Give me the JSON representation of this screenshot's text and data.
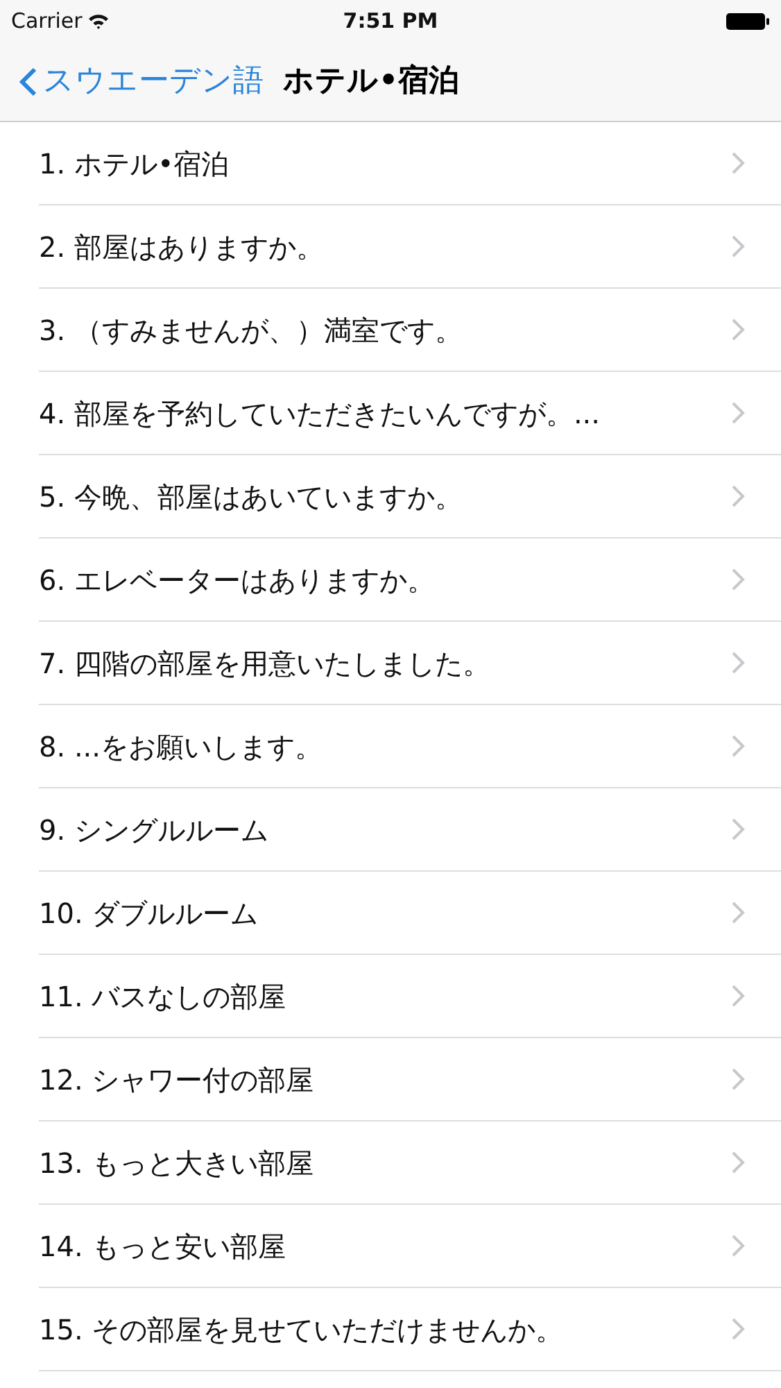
{
  "status_bar": {
    "carrier": "Carrier",
    "time": "7:51 PM"
  },
  "nav_bar": {
    "back": "スウエーデン語",
    "title": "ホテル•宿泊"
  },
  "items": [
    {
      "label": "1. ホテル•宿泊"
    },
    {
      "label": "2. 部屋はありますか。"
    },
    {
      "label": "3. （すみませんが、）満室です。"
    },
    {
      "label": "4. 部屋を予約していただきたいんですが。..."
    },
    {
      "label": "5. 今晩、部屋はあいていますか。"
    },
    {
      "label": "6. エレベーターはありますか。"
    },
    {
      "label": "7. 四階の部屋を用意いたしました。"
    },
    {
      "label": "8. ...をお願いします。"
    },
    {
      "label": "9. シングルルーム"
    },
    {
      "label": "10. ダブルルーム"
    },
    {
      "label": "11. バスなしの部屋"
    },
    {
      "label": "12. シャワー付の部屋"
    },
    {
      "label": "13. もっと大きい部屋"
    },
    {
      "label": "14. もっと安い部屋"
    },
    {
      "label": "15. その部屋を見せていただけませんか。"
    }
  ]
}
